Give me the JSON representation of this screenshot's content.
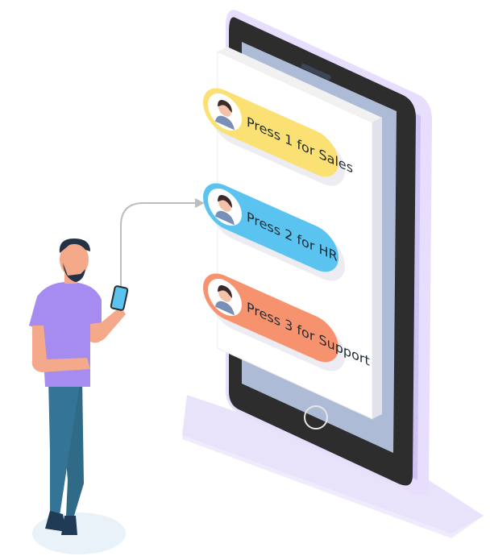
{
  "menu": {
    "options": [
      {
        "label": "Press 1 for Sales",
        "color": "#fbe173",
        "avatar_bg": "#ffffff"
      },
      {
        "label": "Press 2 for HR",
        "color": "#5bc3f0",
        "avatar_bg": "#ffffff"
      },
      {
        "label": "Press 3 for Support",
        "color": "#f7926e",
        "avatar_bg": "#ffffff"
      }
    ]
  },
  "colors": {
    "phone_body": "#e6defc",
    "phone_frame": "#2b2b2b",
    "screen_back": "#aebbd6",
    "card": "#ffffff",
    "person_shirt": "#a68bf0",
    "person_pants": "#2f6a86",
    "person_skin": "#f4a98a",
    "person_hair": "#223247",
    "arrow": "#bdbdbd"
  },
  "icons": [
    "phone-illustration",
    "person-illustration",
    "agent-avatar-icon",
    "arrow-connector",
    "home-button-icon"
  ]
}
